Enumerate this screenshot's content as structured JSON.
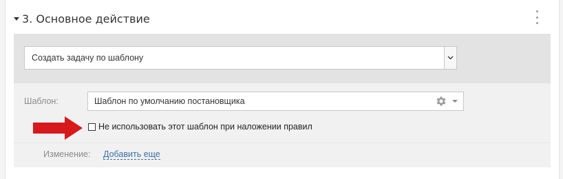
{
  "section": {
    "title": "3. Основное действие",
    "caret_icon": "caret-down-icon",
    "menu_icon": "kebab-menu-icon"
  },
  "action": {
    "selected_value": "Создать задачу по шаблону",
    "dropdown_icon": "chevron-down-icon"
  },
  "template": {
    "label": "Шаблон:",
    "selected_value": "Шаблон по умолчанию постановщика",
    "settings_icon": "gear-icon",
    "dropdown_icon": "caret-down-icon"
  },
  "rules_checkbox": {
    "label": "Не использовать этот шаблон при наложении правил",
    "checked": false
  },
  "annotation": {
    "arrow_icon": "red-arrow-icon",
    "arrow_color": "#d7191c"
  },
  "change": {
    "label": "Изменение:",
    "add_more_link": "Добавить еще"
  },
  "colors": {
    "link": "#3a6ea5",
    "action_block_bg": "#e3e3e3",
    "template_block_bg": "#f1f1f1"
  }
}
